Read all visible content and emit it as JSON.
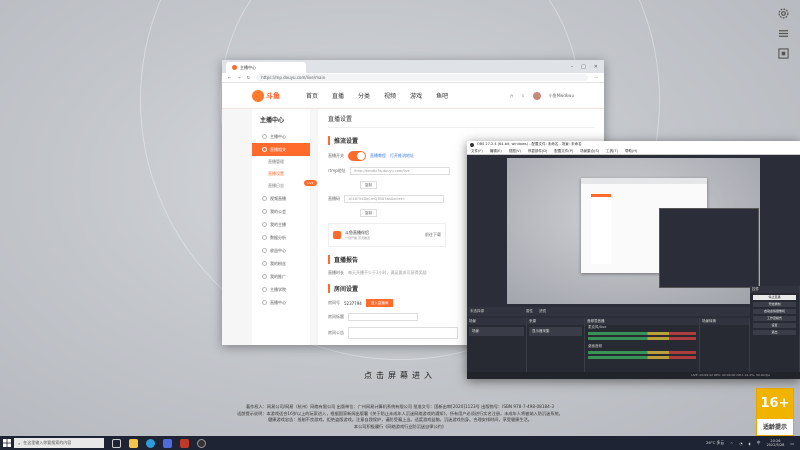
{
  "browser": {
    "tab_title": "主播中心",
    "url": "https://mp.douyu.com/live/main",
    "logo_text": "斗鱼",
    "nav": [
      "首页",
      "直播",
      "分类",
      "视频",
      "游戏",
      "鱼吧"
    ],
    "user_name": "小鱼Mwdkwu",
    "sidebar": {
      "title": "主播中心",
      "items": [
        {
          "label": "主播中心",
          "active": false
        },
        {
          "label": "直播相关",
          "active": true
        },
        {
          "label": "视频直播",
          "active": false
        },
        {
          "label": "我的公会",
          "active": false
        },
        {
          "label": "我的主播",
          "active": false
        },
        {
          "label": "数据分析",
          "active": false
        },
        {
          "label": "收益中心",
          "active": false
        },
        {
          "label": "我的粉丝",
          "active": false
        },
        {
          "label": "我的推广",
          "active": false
        },
        {
          "label": "主播学院",
          "active": false
        },
        {
          "label": "直播中心",
          "active": false
        }
      ],
      "sub_items": [
        "直播管理",
        "直播设置",
        "直播日志"
      ]
    },
    "main": {
      "title": "直播设置",
      "sec1": "推流设置",
      "push_label": "直播开关",
      "push_link1": "直播教程",
      "push_link2": "打开推流地址",
      "rtmp_label": "rtmp地址",
      "rtmp_value": "rtmp://sendtc3a.douyu.com/live",
      "copy": "复制",
      "code_label": "直播码",
      "code_value": "1016754DqCmQTBD?wsSecret=",
      "card_title": "斗鱼直播伴侣",
      "card_sub": "一键开播 高清推流",
      "card_btn": "前往下载",
      "sec2": "直播报告",
      "report_label": "直播时长",
      "report_value": "每天开播不少于3小时，满足要求可获得奖励",
      "sec3": "房间设置",
      "room_label": "房间号",
      "room_value": "5237794",
      "room_btn": "进入直播间",
      "title_label": "房间标题",
      "notice_label": "房间公告"
    }
  },
  "obs": {
    "title": "OBS 27.2.4 (64-bit, windows) - 配置文件: 未命名 - 场景: 未命名",
    "menu": [
      "文件(F)",
      "编辑(E)",
      "视图(V)",
      "停靠部件(D)",
      "配置文件(P)",
      "场景集合(S)",
      "工具(T)",
      "帮助(H)"
    ],
    "no_source": "未选择源",
    "props": "属性",
    "filters": "滤镜",
    "panels": [
      "场景",
      "来源",
      "音频混音器",
      "场景转换",
      "控件"
    ],
    "scene_item": "场景",
    "source_item": "显示器采集",
    "mixer": [
      {
        "label": "麦克风/Aux"
      },
      {
        "label": "桌面音频"
      }
    ],
    "controls": [
      "停止直播",
      "开始录制",
      "启动虚拟摄像机",
      "工作室模式",
      "设置",
      "退出"
    ],
    "status": "LIVE: 00:09:42  REC: 00:00:00  CPU: 12.4%, 30.00 fps"
  },
  "enter_text": "点击屏幕进入",
  "legal": [
    "著作权人：网易公司/网易（杭州）网络有限公司  出版单位：广州网易计算机系统有限公司  批准文号：国新出审[2020]1123号  出版物号：ISBN 978-7-498-08184-3",
    "适龄提示说明：本游戏适合16岁以上的玩家进入，根据国家新闻出版署《关于防止未成年人沉迷网络游戏的通知》，所有用户必须进行实名注册，未成年人将被纳入防沉迷系统。",
    "健康游戏忠告：抵制不良游戏，拒绝盗版游戏。注意自我保护，谨防受骗上当。适度游戏益脑，沉迷游戏伤身。合理安排时间，享受健康生活。",
    "本公司积极履行《网络游戏行业防沉迷自律公约》"
  ],
  "age": {
    "rating": "16+",
    "label": "适龄提示",
    "color": "#f0b400"
  },
  "taskbar": {
    "search_placeholder": "在这里输入你要搜索的内容",
    "weather": "26°C 多云",
    "ime": "中",
    "time": "20:26",
    "date": "2022/5/28"
  }
}
